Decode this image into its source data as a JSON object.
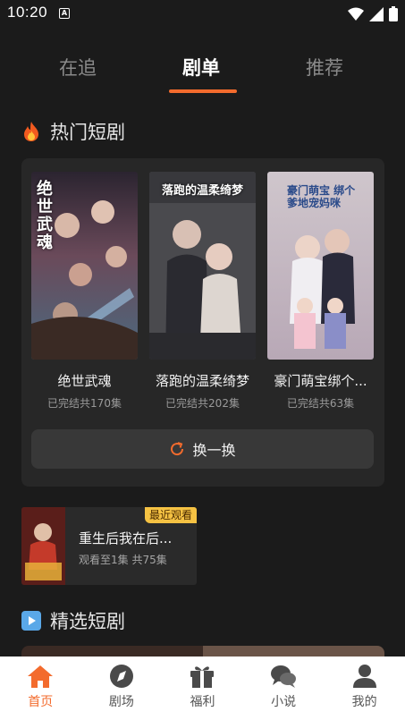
{
  "status_bar": {
    "time": "10:20",
    "notification_icon": "A"
  },
  "tabs": [
    {
      "label": "在追"
    },
    {
      "label": "剧单"
    },
    {
      "label": "推荐"
    }
  ],
  "hot_section": {
    "title": "热门短剧",
    "icon": "fire-icon",
    "dramas": [
      {
        "name": "绝世武魂",
        "meta": "已完结共170集",
        "poster_text": "绝世武魂"
      },
      {
        "name": "落跑的温柔绮梦",
        "meta": "已完结共202集",
        "poster_text": "落跑的温柔绮梦"
      },
      {
        "name": "豪门萌宝绑个...",
        "meta": "已完结共63集",
        "poster_text": "豪门萌宝 绑个爹地宠妈咪"
      }
    ],
    "refresh_label": "换一换"
  },
  "recent": {
    "badge": "最近观看",
    "title": "重生后我在后...",
    "meta": "观看至1集 共75集"
  },
  "picks_section": {
    "title": "精选短剧",
    "icon": "play-icon"
  },
  "bottom_nav": [
    {
      "label": "首页",
      "icon": "home-icon",
      "active": true
    },
    {
      "label": "剧场",
      "icon": "compass-icon",
      "active": false
    },
    {
      "label": "福利",
      "icon": "gift-icon",
      "active": false
    },
    {
      "label": "小说",
      "icon": "chat-icon",
      "active": false
    },
    {
      "label": "我的",
      "icon": "user-icon",
      "active": false
    }
  ],
  "colors": {
    "accent": "#f36b2d",
    "background": "#1b1b1b",
    "panel": "#272727",
    "badge": "#f5c243"
  }
}
